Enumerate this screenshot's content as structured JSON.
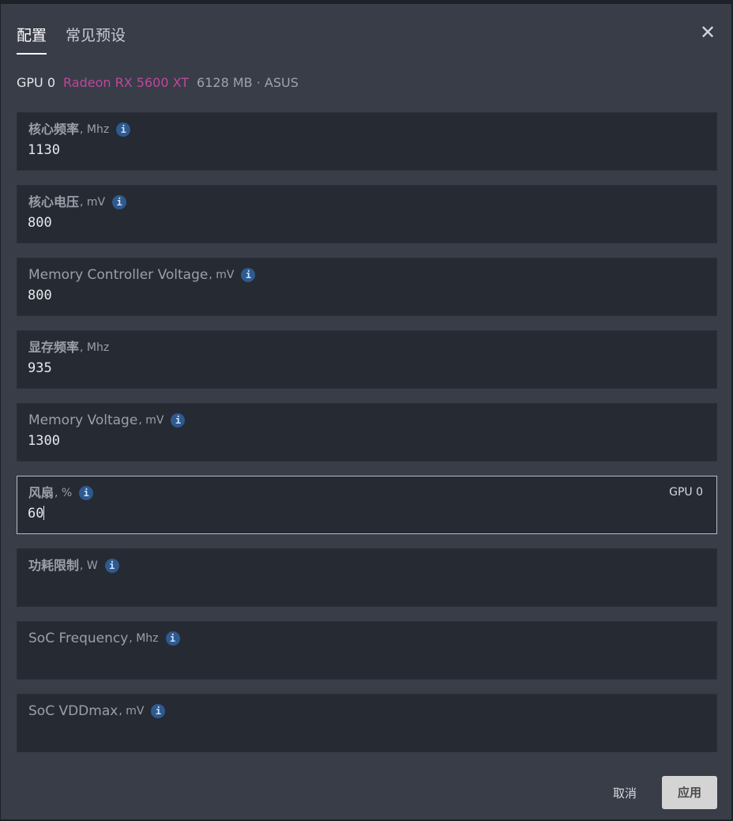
{
  "tabs": [
    {
      "label": "配置",
      "active": true
    },
    {
      "label": "常见预设",
      "active": false
    }
  ],
  "gpu": {
    "id": "GPU 0",
    "name": "Radeon RX 5600 XT",
    "meta": "6128 MB · ASUS"
  },
  "fields": [
    {
      "label": "核心频率",
      "unit": ", Mhz",
      "value": "1130",
      "info": true
    },
    {
      "label": "核心电压",
      "unit": ", mV",
      "value": "800",
      "info": true
    },
    {
      "label": "Memory Controller Voltage",
      "unit": ", mV",
      "value": "800",
      "info": true
    },
    {
      "label": "显存频率",
      "unit": ", Mhz",
      "value": "935",
      "info": false
    },
    {
      "label": "Memory Voltage",
      "unit": ", mV",
      "value": "1300",
      "info": true
    },
    {
      "label": "风扇",
      "unit": ", %",
      "value": "60",
      "info": true,
      "tag": "GPU 0"
    },
    {
      "label": "功耗限制",
      "unit": ", W",
      "value": "",
      "info": true
    },
    {
      "label": "SoC Frequency",
      "unit": ", Mhz",
      "value": "",
      "info": true
    },
    {
      "label": "SoC VDDmax",
      "unit": ", mV",
      "value": "",
      "info": true
    }
  ],
  "icons": {
    "info": "i",
    "close": "✕"
  },
  "buttons": {
    "cancel": "取消",
    "apply": "应用"
  },
  "colors": {
    "dialog_bg": "#383d48",
    "field_bg": "#262a33",
    "gpu_name": "#c0479a",
    "info_badge": "#2e5a8e",
    "apply_bg": "#d4d4d4"
  }
}
